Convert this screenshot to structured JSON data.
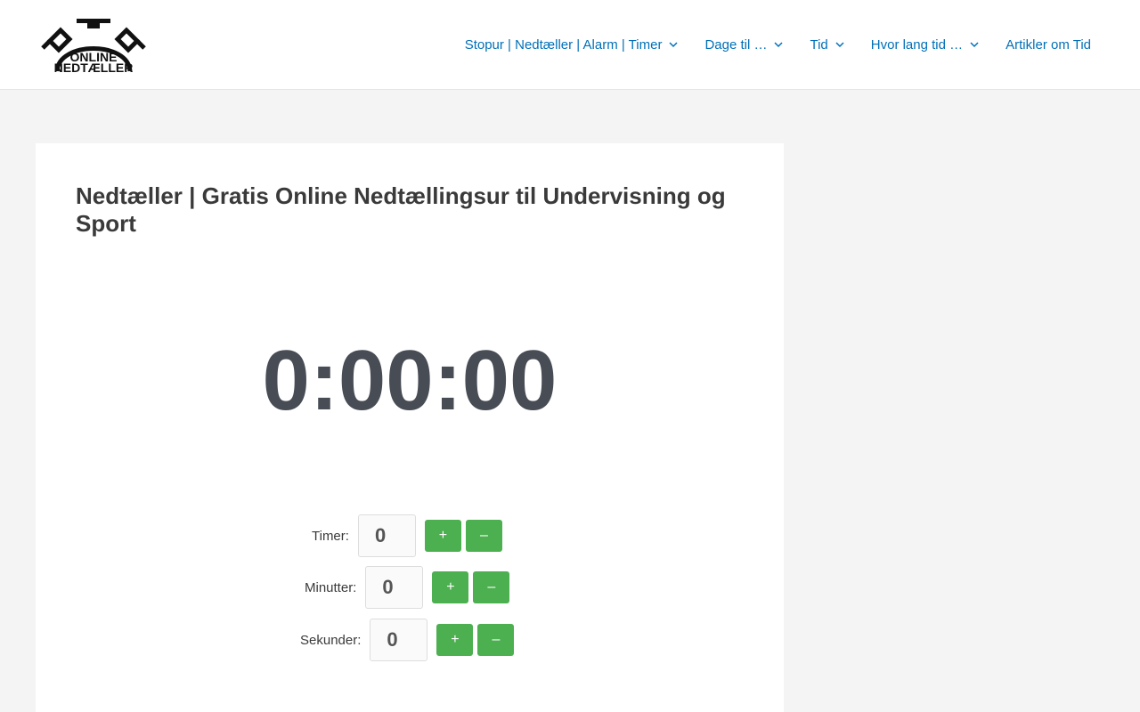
{
  "logo": {
    "line1": "ONLINE",
    "line2": "NEDTÆLLER"
  },
  "nav": [
    {
      "label": "Stopur | Nedtæller | Alarm | Timer",
      "has_dropdown": true
    },
    {
      "label": "Dage til …",
      "has_dropdown": true
    },
    {
      "label": "Tid",
      "has_dropdown": true
    },
    {
      "label": "Hvor lang tid …",
      "has_dropdown": true
    },
    {
      "label": "Artikler om Tid",
      "has_dropdown": false
    }
  ],
  "page": {
    "title": "Nedtæller | Gratis Online Nedtællingsur til Undervisning og Sport",
    "clock": "0:00:00"
  },
  "inputs": {
    "hours": {
      "label": "Timer:",
      "value": "0",
      "plus": "+",
      "minus": "–"
    },
    "minutes": {
      "label": "Minutter:",
      "value": "0",
      "plus": "+",
      "minus": "–"
    },
    "seconds": {
      "label": "Sekunder:",
      "value": "0",
      "plus": "+",
      "minus": "–"
    }
  },
  "colors": {
    "link": "#0170b9",
    "button": "#4caf50",
    "clock": "#474c55"
  }
}
